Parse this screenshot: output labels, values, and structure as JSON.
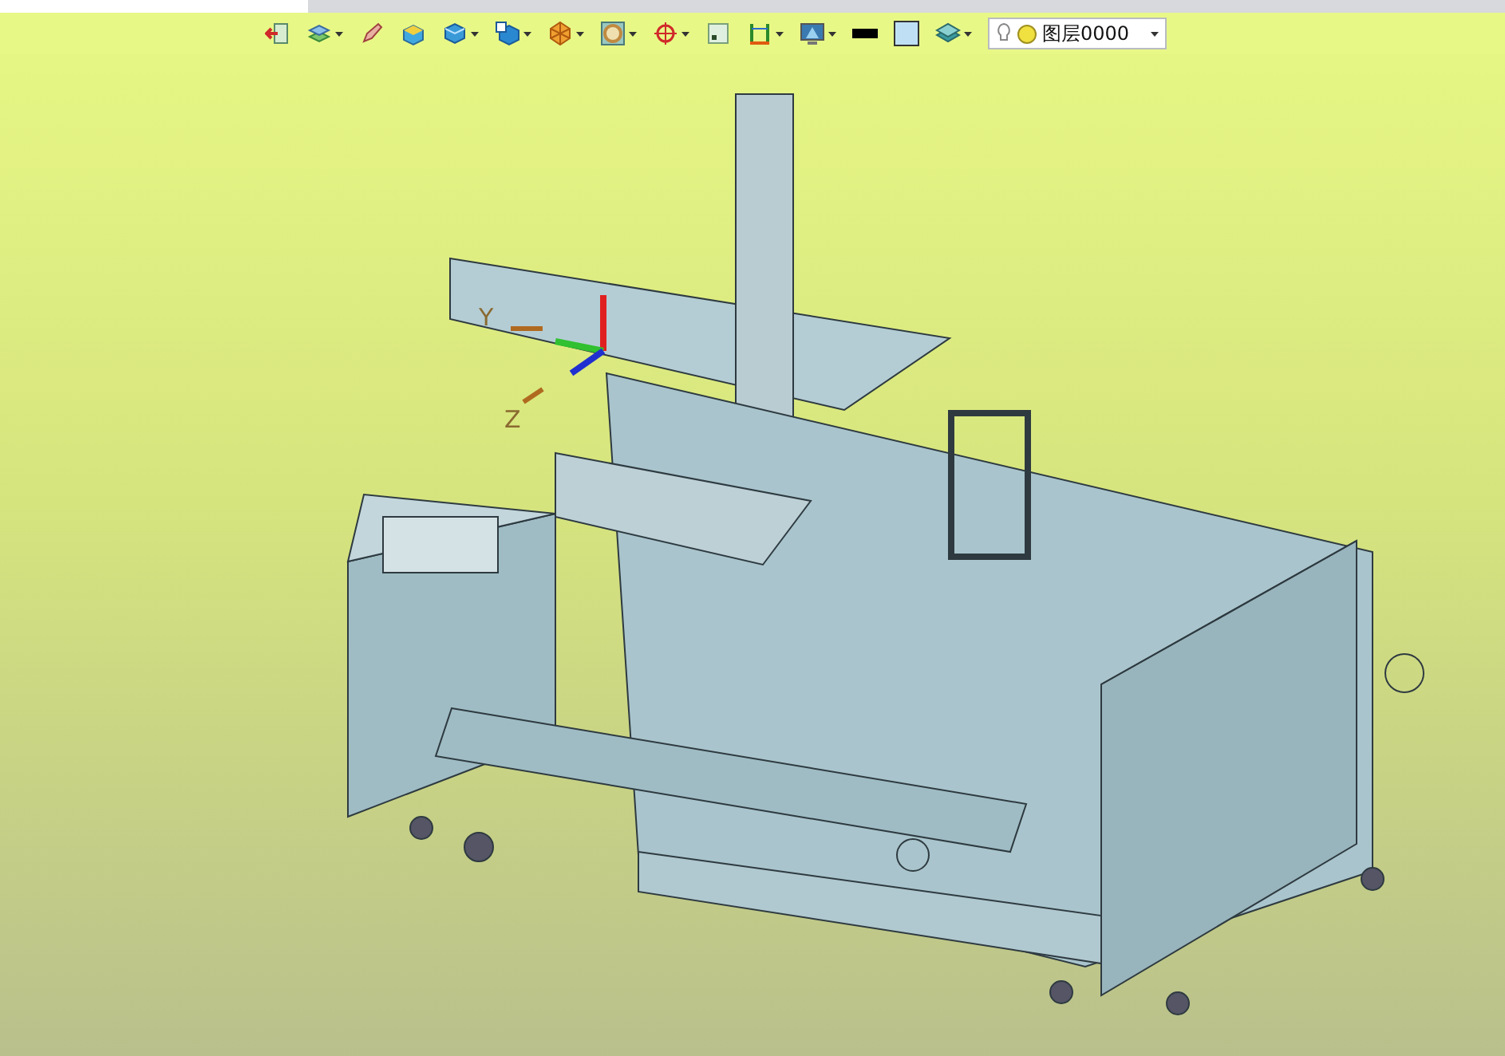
{
  "toolbar": {
    "tools": [
      {
        "kind": "exit",
        "dropdown": false
      },
      {
        "kind": "sketch-plane",
        "dropdown": true
      },
      {
        "kind": "pencil",
        "dropdown": false
      },
      {
        "kind": "plane-box",
        "dropdown": false
      },
      {
        "kind": "cube",
        "dropdown": true
      },
      {
        "kind": "view-cube",
        "dropdown": true
      },
      {
        "kind": "polygon",
        "dropdown": true
      },
      {
        "kind": "ring",
        "dropdown": true
      },
      {
        "kind": "target",
        "dropdown": true
      },
      {
        "kind": "frame",
        "dropdown": false
      },
      {
        "kind": "dimension",
        "dropdown": true
      },
      {
        "kind": "monitor",
        "dropdown": true
      },
      {
        "kind": "line-color",
        "dropdown": false
      },
      {
        "kind": "fill-color",
        "dropdown": false
      },
      {
        "kind": "layers",
        "dropdown": true
      }
    ],
    "layer_select": {
      "value": "图层0000",
      "visible": true
    }
  },
  "viewport": {
    "axes": [
      {
        "label": "Y"
      },
      {
        "label": "Z"
      }
    ]
  }
}
